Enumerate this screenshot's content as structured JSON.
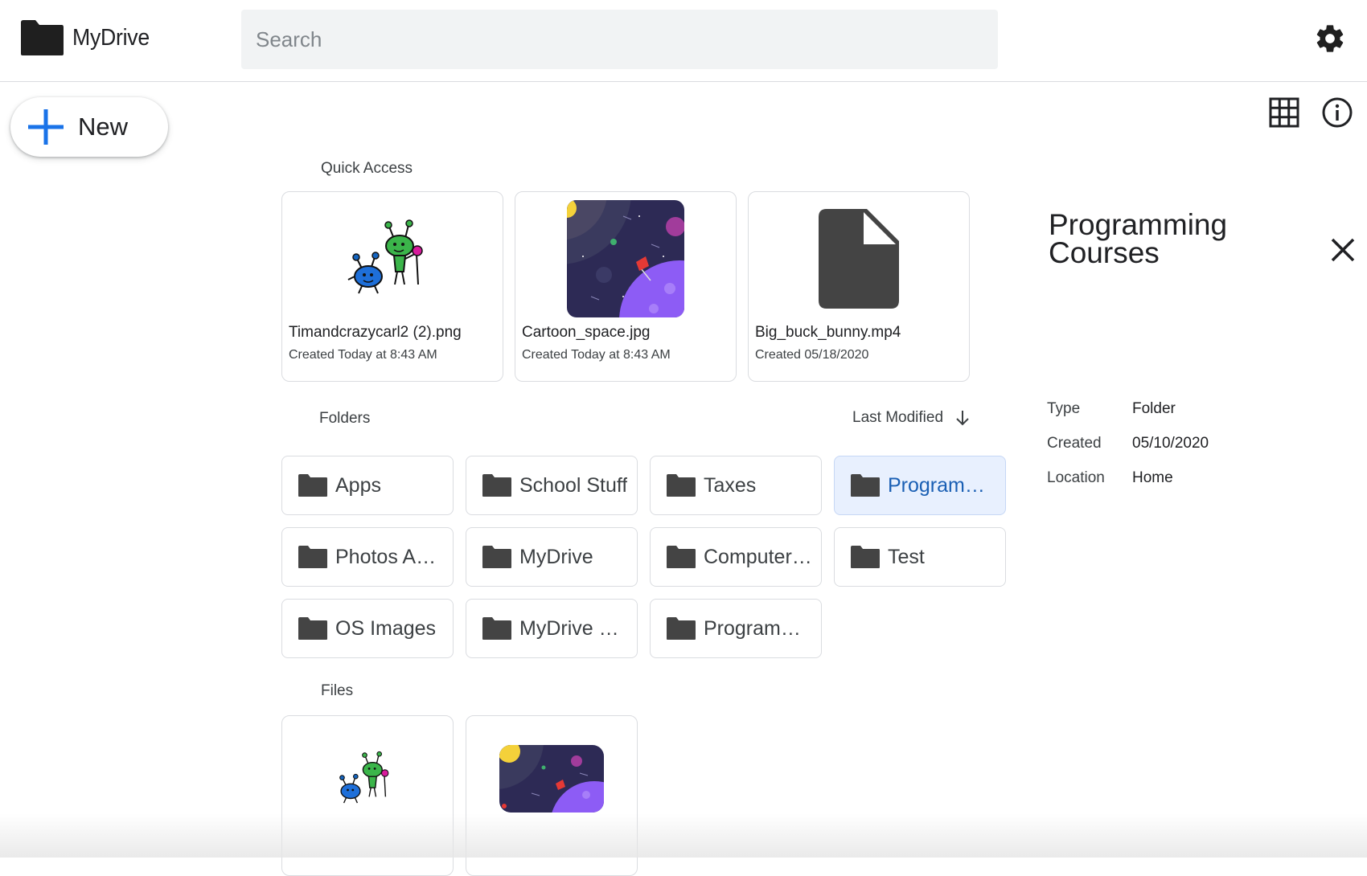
{
  "app": {
    "title": "MyDrive"
  },
  "search": {
    "placeholder": "Search"
  },
  "toolbar": {
    "new_label": "New"
  },
  "icons": {
    "logo": "folder-icon",
    "settings": "gear-icon",
    "new": "plus-icon",
    "grid_view": "grid-icon",
    "info": "info-icon",
    "close": "close-icon",
    "sort": "arrow-down-icon"
  },
  "colors": {
    "accent": "#1a73e8",
    "selected_bg": "#e8f0fe",
    "selected_text": "#1a5fb4",
    "folder": "#444444"
  },
  "quick_access": {
    "label": "Quick Access",
    "items": [
      {
        "name": "Timandcrazycarl2 (2).png",
        "meta": "Created Today at 8:43 AM",
        "thumb": "aliens-image"
      },
      {
        "name": "Cartoon_space.jpg",
        "meta": "Created Today at 8:43 AM",
        "thumb": "space-image"
      },
      {
        "name": "Big_buck_bunny.mp4",
        "meta": "Created 05/18/2020",
        "thumb": "file-icon"
      }
    ]
  },
  "folders": {
    "label": "Folders",
    "sort_label": "Last Modified",
    "items": [
      {
        "name": "Apps"
      },
      {
        "name": "School Stuff"
      },
      {
        "name": "Taxes"
      },
      {
        "name": "Programming Courses",
        "selected": true
      },
      {
        "name": "Photos And Videos"
      },
      {
        "name": "MyDrive"
      },
      {
        "name": "Computer Science"
      },
      {
        "name": "Test"
      },
      {
        "name": "OS Images"
      },
      {
        "name": "MyDrive Videos"
      },
      {
        "name": "Programming"
      }
    ]
  },
  "files": {
    "label": "Files",
    "items": [
      {
        "thumb": "aliens-image"
      },
      {
        "thumb": "space-image"
      }
    ]
  },
  "details": {
    "title": "Programming Courses",
    "rows": [
      {
        "key": "Type",
        "value": "Folder"
      },
      {
        "key": "Created",
        "value": "05/10/2020"
      },
      {
        "key": "Location",
        "value": "Home"
      }
    ]
  }
}
